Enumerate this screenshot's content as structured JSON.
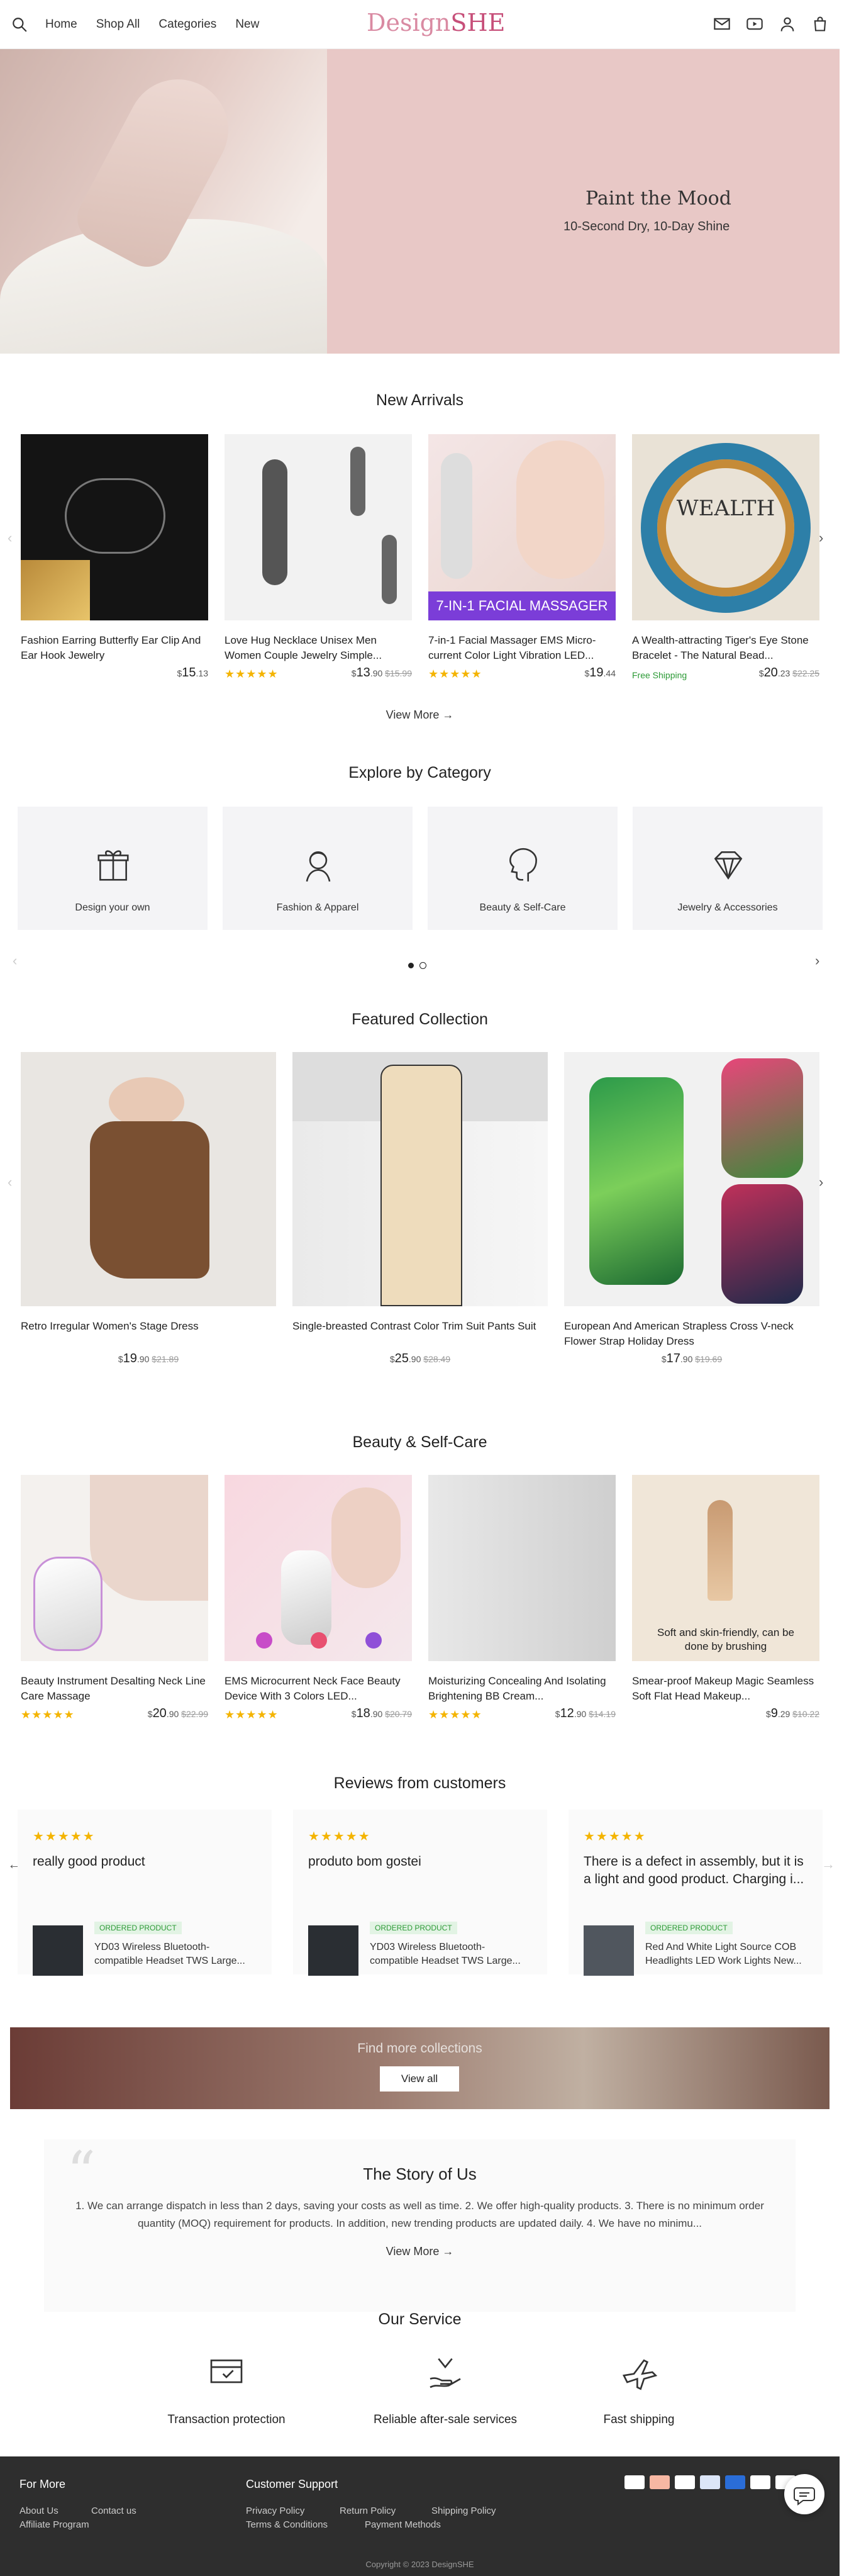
{
  "header": {
    "nav": [
      "Home",
      "Shop All",
      "Categories",
      "New"
    ],
    "logo_a": "Design",
    "logo_b": "SHE"
  },
  "hero": {
    "title": "Paint the Mood",
    "subtitle": "10-Second Dry, 10-Day Shine",
    "slides": 3,
    "active_slide": 1
  },
  "new_arrivals": {
    "title": "New Arrivals",
    "items": [
      {
        "name": "Fashion Earring Butterfly Ear Clip And Ear Hook Jewelry",
        "price_int": "15",
        "price_dec": ".13",
        "old": "",
        "rating": "★★★★★",
        "ship": ""
      },
      {
        "name": "Love Hug Necklace Unisex Men Women Couple Jewelry Simple...",
        "price_int": "13",
        "price_dec": ".90",
        "old": "$15.99",
        "rating": "★★★★★",
        "ship": ""
      },
      {
        "name": "7-in-1 Facial Massager EMS Micro-current Color Light Vibration LED...",
        "price_int": "19",
        "price_dec": ".44",
        "old": "",
        "rating": "★★★★★",
        "ship": "",
        "overlay": "7-IN-1 FACIAL MASSAGER"
      },
      {
        "name": "A Wealth-attracting Tiger's Eye Stone Bracelet - The Natural Bead...",
        "price_int": "20",
        "price_dec": ".23",
        "old": "$22.25",
        "rating": "",
        "ship": "Free Shipping",
        "overlay": "WEALTH"
      }
    ],
    "view_more": "View More"
  },
  "categories": {
    "title": "Explore by Category",
    "items": [
      "Design your own",
      "Fashion & Apparel",
      "Beauty & Self-Care",
      "Jewelry & Accessories"
    ],
    "pages": 2,
    "active_page": 1
  },
  "featured": {
    "title": "Featured Collection",
    "items": [
      {
        "name": "Retro Irregular Women's Stage Dress",
        "price_int": "19",
        "price_dec": ".90",
        "old": "$21.89"
      },
      {
        "name": "Single-breasted Contrast Color Trim Suit Pants Suit",
        "price_int": "25",
        "price_dec": ".90",
        "old": "$28.49"
      },
      {
        "name": "European And American Strapless Cross V-neck Flower Strap Holiday Dress",
        "price_int": "17",
        "price_dec": ".90",
        "old": "$19.69"
      }
    ]
  },
  "beauty": {
    "title": "Beauty & Self-Care",
    "items": [
      {
        "name": "Beauty Instrument Desalting Neck Line Care Massage",
        "price_int": "20",
        "price_dec": ".90",
        "old": "$22.99",
        "rating": "★★★★★"
      },
      {
        "name": "EMS Microcurrent Neck Face Beauty Device With 3 Colors LED...",
        "price_int": "18",
        "price_dec": ".90",
        "old": "$20.79",
        "rating": "★★★★★"
      },
      {
        "name": "Moisturizing Concealing And Isolating Brightening BB Cream...",
        "price_int": "12",
        "price_dec": ".90",
        "old": "$14.19",
        "rating": "★★★★★"
      },
      {
        "name": "Smear-proof Makeup Magic Seamless Soft Flat Head Makeup...",
        "price_int": "9",
        "price_dec": ".29",
        "old": "$10.22",
        "rating": "",
        "overlay": "Soft and skin-friendly, can be done by brushing"
      }
    ]
  },
  "reviews": {
    "title": "Reviews from customers",
    "items": [
      {
        "stars": "★★★★★",
        "text": "really good product",
        "tag": "ORDERED PRODUCT",
        "product": "YD03 Wireless Bluetooth-compatible Headset TWS Large..."
      },
      {
        "stars": "★★★★★",
        "text": "produto bom gostei",
        "tag": "ORDERED PRODUCT",
        "product": "YD03 Wireless Bluetooth-compatible Headset TWS Large..."
      },
      {
        "stars": "★★★★★",
        "text": "There is a defect in assembly, but it is a light and good product. Charging i...",
        "tag": "ORDERED PRODUCT",
        "product": "Red And White Light Source COB Headlights LED Work Lights New..."
      }
    ]
  },
  "banner": {
    "text": "Find more collections",
    "button": "View all"
  },
  "story": {
    "title": "The Story of Us",
    "text": "1. We can arrange dispatch in less than 2 days, saving your costs as well as time. 2. We offer high-quality products. 3. There is no minimum order quantity (MOQ) requirement for products. In addition, new trending products are updated daily. 4. We have no minimu...",
    "view_more": "View More"
  },
  "service": {
    "title": "Our Service",
    "items": [
      "Transaction protection",
      "Reliable after-sale services",
      "Fast shipping"
    ]
  },
  "footer": {
    "for_more": "For More",
    "for_more_links": [
      "About Us",
      "Contact us",
      "Affiliate Program"
    ],
    "support": "Customer Support",
    "support_links": [
      "Privacy Policy",
      "Return Policy",
      "Shipping Policy",
      "Terms & Conditions",
      "Payment Methods"
    ],
    "copyright": "Copyright © 2023 DesignSHE"
  },
  "colors": {
    "brand": "#c7507a",
    "hero_bg": "#e8c8c6",
    "star": "#f4b400",
    "footer_bg": "#2e2e2e"
  }
}
